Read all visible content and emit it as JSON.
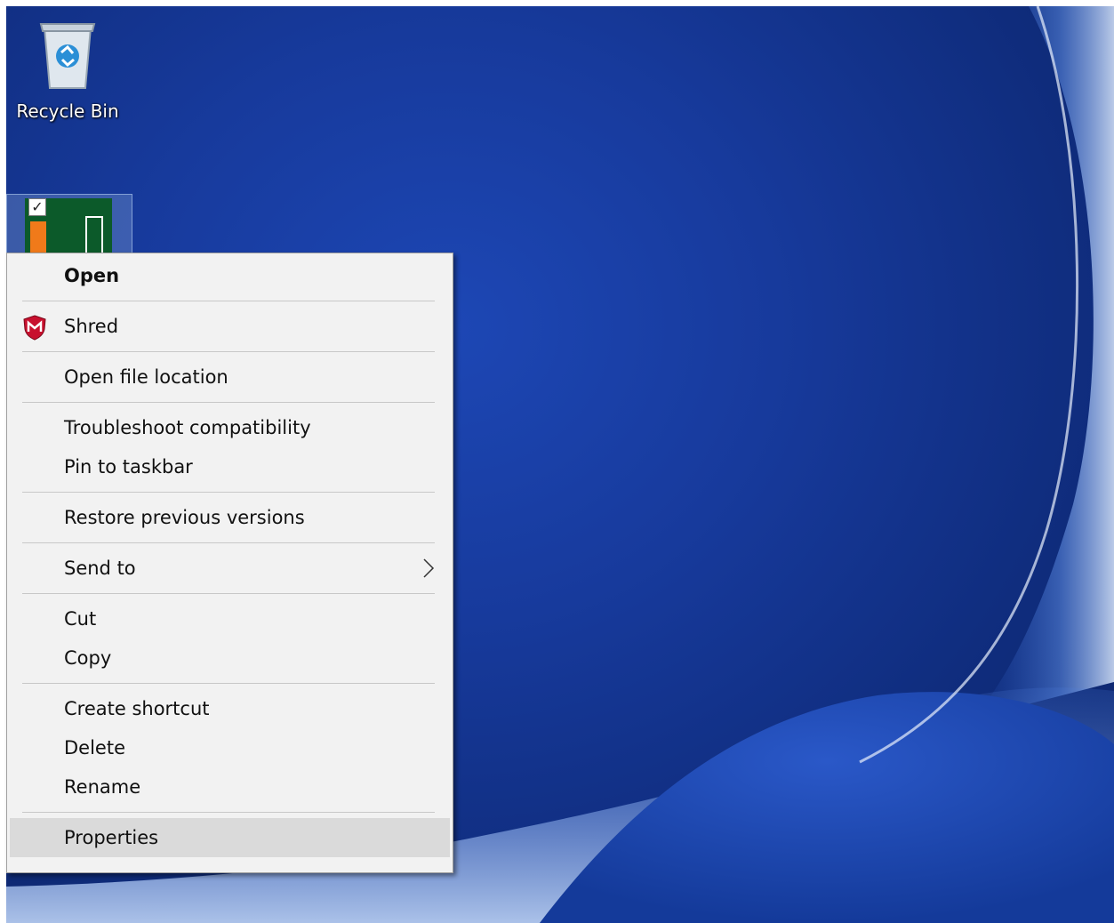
{
  "desktop": {
    "icons": {
      "recycle_bin": "Recycle Bin"
    },
    "colors": {
      "wallpaper_dark": "#0b2366",
      "wallpaper_mid": "#1d47b5",
      "wallpaper_light": "#8fb3ee",
      "app_tile": "#0c5a2a",
      "app_bar": "#f07a1a"
    }
  },
  "context_menu": {
    "items": [
      {
        "label": "Open",
        "bold": true
      },
      {
        "label": "Shred",
        "icon": "mcafee-shield-icon"
      },
      {
        "label": "Open file location"
      },
      {
        "label": "Troubleshoot compatibility"
      },
      {
        "label": "Pin to taskbar"
      },
      {
        "label": "Restore previous versions"
      },
      {
        "label": "Send to",
        "submenu": true
      },
      {
        "label": "Cut"
      },
      {
        "label": "Copy"
      },
      {
        "label": "Create shortcut"
      },
      {
        "label": "Delete"
      },
      {
        "label": "Rename"
      },
      {
        "label": "Properties",
        "highlighted": true
      }
    ]
  }
}
